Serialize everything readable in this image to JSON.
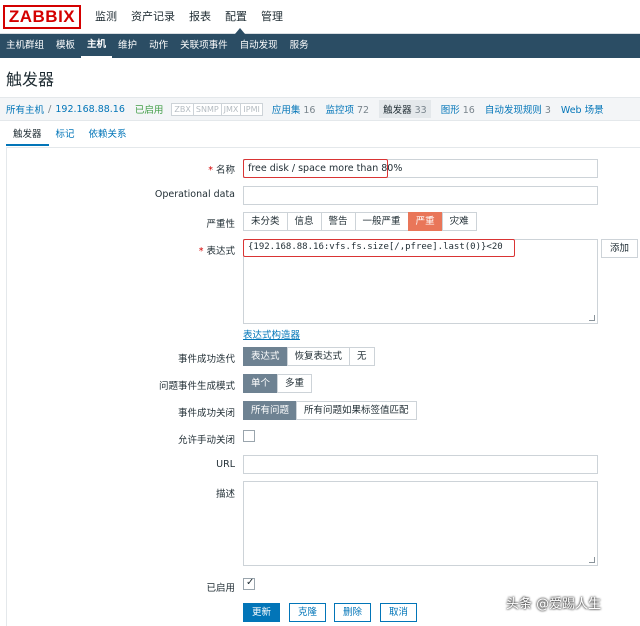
{
  "app": {
    "logo": "ZABBIX"
  },
  "topmenu": [
    "监测",
    "资产记录",
    "报表",
    "配置",
    "管理"
  ],
  "submenu": [
    "主机群组",
    "模板",
    "主机",
    "维护",
    "动作",
    "关联项事件",
    "自动发现",
    "服务"
  ],
  "page_title": "触发器",
  "hostnav": {
    "all_hosts": "所有主机",
    "sep": "/",
    "host": "192.168.88.16",
    "status": "已启用",
    "badges": [
      "ZBX",
      "SNMP",
      "JMX",
      "IPMI"
    ],
    "applications": {
      "label": "应用集",
      "count": "16"
    },
    "items": {
      "label": "监控项",
      "count": "72"
    },
    "triggers": {
      "label": "触发器",
      "count": "33"
    },
    "graphs": {
      "label": "图形",
      "count": "16"
    },
    "discovery": {
      "label": "自动发现规则",
      "count": "3"
    },
    "web": "Web 场景"
  },
  "tabs": [
    "触发器",
    "标记",
    "依赖关系"
  ],
  "form": {
    "name_label": "名称",
    "name_value": "free disk /  space more than 80%",
    "opdata_label": "Operational data",
    "opdata_value": "",
    "severity_label": "严重性",
    "severity_options": [
      "未分类",
      "信息",
      "警告",
      "一般严重",
      "严重",
      "灾难"
    ],
    "severity_selected": "严重",
    "expression_label": "表达式",
    "expression_value": "{192.168.88.16:vfs.fs.size[/,pfree].last(0)}<20",
    "add_button": "添加",
    "expression_builder": "表达式构造器",
    "ok_event_label": "事件成功迭代",
    "ok_event_options": [
      "表达式",
      "恢复表达式",
      "无"
    ],
    "problem_mode_label": "问题事件生成模式",
    "problem_mode_options": [
      "单个",
      "多重"
    ],
    "ok_close_label": "事件成功关闭",
    "ok_close_options": [
      "所有问题",
      "所有问题如果标签值匹配"
    ],
    "manual_close_label": "允许手动关闭",
    "manual_close_checked": false,
    "url_label": "URL",
    "url_value": "",
    "description_label": "描述",
    "description_value": "",
    "enabled_label": "已启用",
    "enabled_checked": true
  },
  "buttons": {
    "update": "更新",
    "clone": "克隆",
    "delete": "删除",
    "cancel": "取消"
  },
  "watermark": "头条 @爱踢人生"
}
